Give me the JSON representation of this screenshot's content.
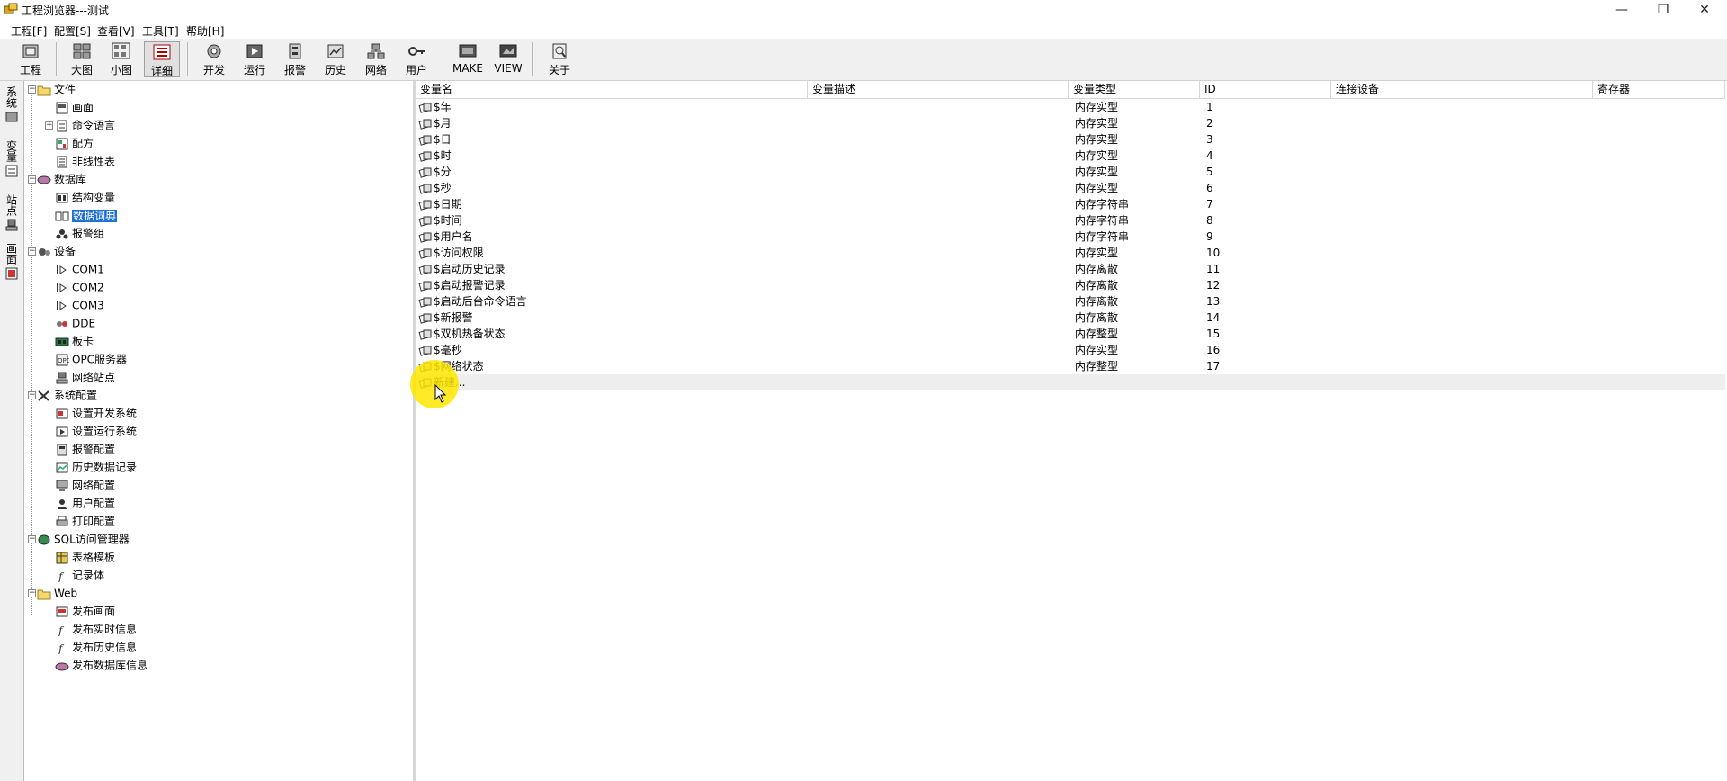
{
  "window": {
    "title": "工程浏览器---测试",
    "minimize": "—",
    "maximize": "❐",
    "close": "✕"
  },
  "menu": [
    "工程[F]",
    "配置[S]",
    "查看[V]",
    "工具[T]",
    "帮助[H]"
  ],
  "toolbar": [
    {
      "label": "工程",
      "icon": "project-icon"
    },
    {
      "label": "大图",
      "icon": "large-icons-icon"
    },
    {
      "label": "小图",
      "icon": "small-icons-icon"
    },
    {
      "label": "详细",
      "icon": "details-icon",
      "active": true
    },
    {
      "label": "开发",
      "icon": "develop-icon"
    },
    {
      "label": "运行",
      "icon": "run-icon"
    },
    {
      "label": "报警",
      "icon": "alarm-icon"
    },
    {
      "label": "历史",
      "icon": "history-icon"
    },
    {
      "label": "网络",
      "icon": "network-icon"
    },
    {
      "label": "用户",
      "icon": "user-key-icon"
    },
    {
      "label": "MAKE",
      "icon": "make-icon"
    },
    {
      "label": "VIEW",
      "icon": "view-icon"
    },
    {
      "label": "关于",
      "icon": "about-icon"
    }
  ],
  "side_tabs": [
    "系统",
    "变量",
    "站点",
    "画面"
  ],
  "tree": [
    {
      "label": "文件",
      "level": 0,
      "icon": "folder-icon",
      "expanded": true
    },
    {
      "label": "画面",
      "level": 1,
      "icon": "screen-icon"
    },
    {
      "label": "命令语言",
      "level": 1,
      "icon": "command-icon",
      "collapsed": true
    },
    {
      "label": "配方",
      "level": 1,
      "icon": "recipe-icon"
    },
    {
      "label": "非线性表",
      "level": 1,
      "icon": "table-icon"
    },
    {
      "label": "数据库",
      "level": 0,
      "icon": "database-icon",
      "expanded": true
    },
    {
      "label": "结构变量",
      "level": 1,
      "icon": "struct-icon"
    },
    {
      "label": "数据词典",
      "level": 1,
      "icon": "dictionary-icon",
      "selected": true
    },
    {
      "label": "报警组",
      "level": 1,
      "icon": "alarm-group-icon"
    },
    {
      "label": "设备",
      "level": 0,
      "icon": "device-icon",
      "expanded": true
    },
    {
      "label": "COM1",
      "level": 1,
      "icon": "com-port-icon"
    },
    {
      "label": "COM2",
      "level": 1,
      "icon": "com-port-icon"
    },
    {
      "label": "COM3",
      "level": 1,
      "icon": "com-port-icon"
    },
    {
      "label": "DDE",
      "level": 1,
      "icon": "dde-icon"
    },
    {
      "label": "板卡",
      "level": 1,
      "icon": "board-icon"
    },
    {
      "label": "OPC服务器",
      "level": 1,
      "icon": "opc-icon"
    },
    {
      "label": "网络站点",
      "level": 1,
      "icon": "network-station-icon"
    },
    {
      "label": "系统配置",
      "level": 0,
      "icon": "tools-icon",
      "expanded": true
    },
    {
      "label": "设置开发系统",
      "level": 1,
      "icon": "dev-system-icon"
    },
    {
      "label": "设置运行系统",
      "level": 1,
      "icon": "run-system-icon"
    },
    {
      "label": "报警配置",
      "level": 1,
      "icon": "alarm-config-icon"
    },
    {
      "label": "历史数据记录",
      "level": 1,
      "icon": "history-record-icon"
    },
    {
      "label": "网络配置",
      "level": 1,
      "icon": "network-config-icon"
    },
    {
      "label": "用户配置",
      "level": 1,
      "icon": "user-config-icon"
    },
    {
      "label": "打印配置",
      "level": 1,
      "icon": "printer-icon"
    },
    {
      "label": "SQL访问管理器",
      "level": 0,
      "icon": "sql-icon",
      "expanded": true
    },
    {
      "label": "表格模板",
      "level": 1,
      "icon": "template-icon"
    },
    {
      "label": "记录体",
      "level": 1,
      "icon": "record-icon"
    },
    {
      "label": "Web",
      "level": 0,
      "icon": "folder-icon",
      "expanded": true
    },
    {
      "label": "发布画面",
      "level": 1,
      "icon": "publish-screen-icon"
    },
    {
      "label": "发布实时信息",
      "level": 1,
      "icon": "publish-realtime-icon"
    },
    {
      "label": "发布历史信息",
      "level": 1,
      "icon": "publish-history-icon"
    },
    {
      "label": "发布数据库信息",
      "level": 1,
      "icon": "publish-db-icon"
    }
  ],
  "columns": [
    "变量名",
    "变量描述",
    "变量类型",
    "ID",
    "连接设备",
    "寄存器"
  ],
  "rows": [
    {
      "name": "$年",
      "desc": "",
      "type": "内存实型",
      "id": "1"
    },
    {
      "name": "$月",
      "desc": "",
      "type": "内存实型",
      "id": "2"
    },
    {
      "name": "$日",
      "desc": "",
      "type": "内存实型",
      "id": "3"
    },
    {
      "name": "$时",
      "desc": "",
      "type": "内存实型",
      "id": "4"
    },
    {
      "name": "$分",
      "desc": "",
      "type": "内存实型",
      "id": "5"
    },
    {
      "name": "$秒",
      "desc": "",
      "type": "内存实型",
      "id": "6"
    },
    {
      "name": "$日期",
      "desc": "",
      "type": "内存字符串",
      "id": "7"
    },
    {
      "name": "$时间",
      "desc": "",
      "type": "内存字符串",
      "id": "8"
    },
    {
      "name": "$用户名",
      "desc": "",
      "type": "内存字符串",
      "id": "9"
    },
    {
      "name": "$访问权限",
      "desc": "",
      "type": "内存实型",
      "id": "10"
    },
    {
      "name": "$启动历史记录",
      "desc": "",
      "type": "内存离散",
      "id": "11"
    },
    {
      "name": "$启动报警记录",
      "desc": "",
      "type": "内存离散",
      "id": "12"
    },
    {
      "name": "$启动后台命令语言",
      "desc": "",
      "type": "内存离散",
      "id": "13"
    },
    {
      "name": "$新报警",
      "desc": "",
      "type": "内存离散",
      "id": "14"
    },
    {
      "name": "$双机热备状态",
      "desc": "",
      "type": "内存整型",
      "id": "15"
    },
    {
      "name": "$毫秒",
      "desc": "",
      "type": "内存实型",
      "id": "16"
    },
    {
      "name": "$网络状态",
      "desc": "",
      "type": "内存整型",
      "id": "17"
    },
    {
      "name": "新建...",
      "desc": "",
      "type": "",
      "id": ""
    }
  ]
}
